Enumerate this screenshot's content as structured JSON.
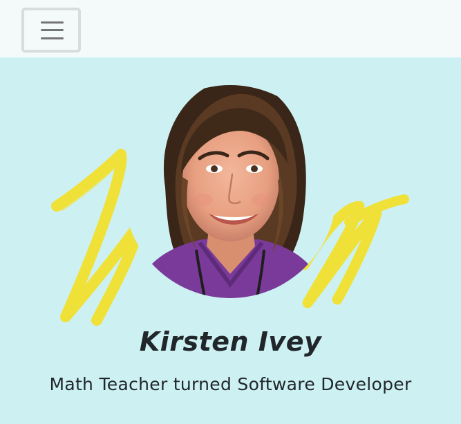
{
  "nav": {
    "menu_toggle_icon": "hamburger-menu-icon"
  },
  "hero": {
    "name": "Kirsten Ivey",
    "tagline": "Math Teacher turned Software Developer",
    "photo_icon": "profile-photo",
    "scribble_icon": "yellow-brush-scribble"
  },
  "colors": {
    "background": "#cdf1f3",
    "navbar": "#f4f9f9",
    "scribble": "#f2e02f",
    "text": "#21262a",
    "shirt": "#7a3a9a"
  }
}
